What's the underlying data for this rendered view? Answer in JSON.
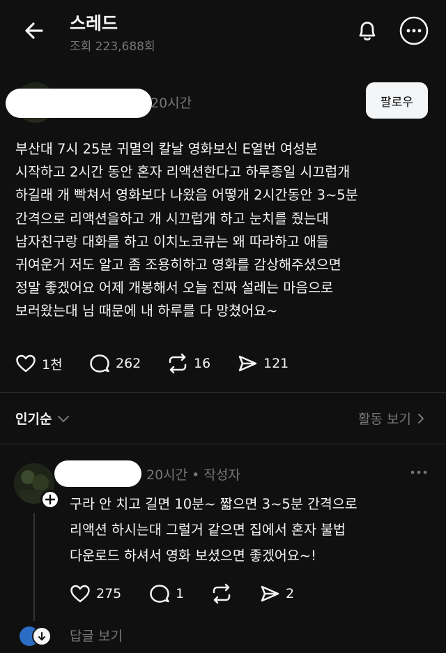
{
  "header": {
    "title": "스레드",
    "views": "조회 223,688회"
  },
  "post": {
    "time": "20시간",
    "follow_label": "팔로우",
    "body": "부산대 7시 25분 귀멸의 칼날 영화보신 E열번 여성분\n시작하고 2시간 동안 혼자 리액션한다고 하루종일 시끄럽개\n하길래 개 빡쳐서 영화보다 나왔음 어떻개 2시간동안 3~5분\n간격으로 리액션을하고 개 시끄럽개 하고 눈치를 줬는대\n남자친구랑 대화를 하고 이치노코큐는 왜 따라하고 애들\n귀여운거 저도 알고 좀 조용히하고 영화를 감상해주셨으면\n정말 좋겠어요 어제 개봉해서 오늘 진짜 설레는 마음으로\n보러왔는대 님 때문에 내 하루를 다 망쳤어요~",
    "likes": "1천",
    "comments": "262",
    "reposts": "16",
    "shares": "121"
  },
  "sort": {
    "label": "인기순",
    "activity_label": "활동 보기"
  },
  "reply": {
    "meta": "20시간 • 작성자",
    "body": "구라 안 치고 길면 10분~ 짧으면 3~5분 간격으로\n리액션 하시는대 그럴거 같으면 집에서 혼자 불법\n다운로드 하셔서 영화 보셨으면 좋겠어요~!",
    "likes": "275",
    "comments": "1",
    "shares": "2",
    "view_replies": "답글 보기"
  }
}
